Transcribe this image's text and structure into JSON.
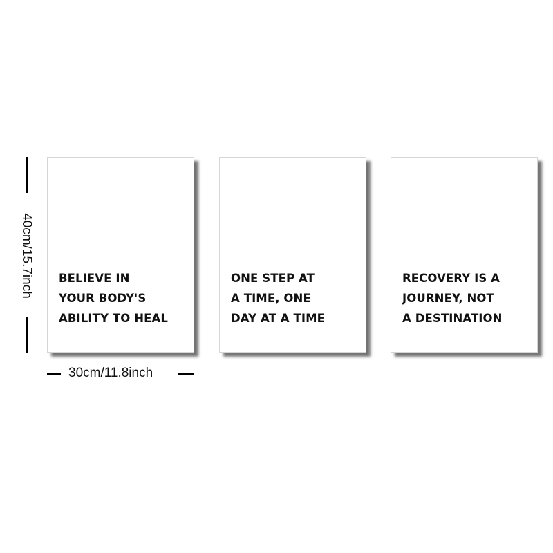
{
  "panels": [
    {
      "lines": [
        "BELIEVE IN",
        "YOUR BODY'S",
        "ABILITY TO HEAL"
      ]
    },
    {
      "lines": [
        "ONE STEP AT",
        "A TIME, ONE",
        "DAY AT A TIME"
      ]
    },
    {
      "lines": [
        "RECOVERY IS A",
        "JOURNEY, NOT",
        "A DESTINATION"
      ]
    }
  ],
  "dimensions": {
    "height_label": "40cm/15.7inch",
    "width_label": "30cm/11.8inch"
  },
  "colors": {
    "background": "#ffffff",
    "text": "#111111",
    "shadow": "#000000"
  }
}
